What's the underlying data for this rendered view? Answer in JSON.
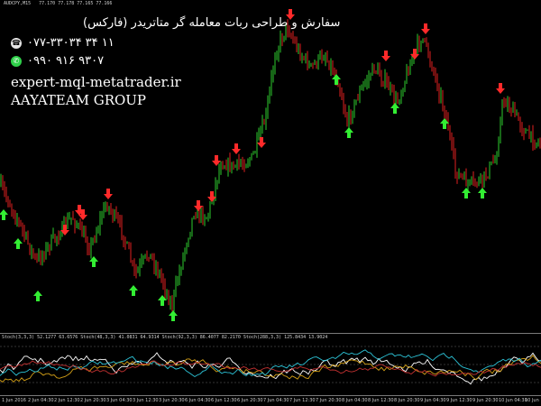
{
  "chart": {
    "header": "AUDCPY,M15   77.170 77.178 77.165 77.166",
    "oscillator_header": "Stoch(3,3,3) 52.1277 63.6576   Stoch(48,3,3) 41.0831 64.9314   Stoch(92,3,3) 86.4077 82.2170   Stoch(288,3,3) 125.8434 13.9024",
    "colors": {
      "bull": "#2ecc2e",
      "bear": "#e02020",
      "buy_arrow": "#33ee33",
      "sell_arrow": "#ff2a2a",
      "osc_lines": [
        "#ffffff",
        "#d4a017",
        "#2cc4d8",
        "#c03030"
      ]
    }
  },
  "promo": {
    "title": "سفارش و طراحی ربات معامله گر متاتریدر (فارکس)",
    "phone": "۰۷۷-۳۳۰۳۴ ۳۴ ۱۱",
    "phone_icon": "phone-icon",
    "whatsapp": "۰۹۹۰ ۹۱۶ ۹۳۰۷",
    "whatsapp_icon": "whatsapp-icon",
    "website": "expert-mql-metatrader.ir",
    "group": "AAYATEAM GROUP"
  },
  "time_axis": [
    "1 Jun 2016",
    "2 Jun 04:30",
    "2 Jun 12:30",
    "2 Jun 20:30",
    "3 Jun 04:30",
    "3 Jun 12:30",
    "3 Jun 20:30",
    "6 Jun 04:30",
    "6 Jun 12:30",
    "6 Jun 20:30",
    "7 Jun 04:30",
    "7 Jun 12:30",
    "7 Jun 20:30",
    "8 Jun 04:30",
    "8 Jun 12:30",
    "8 Jun 20:30",
    "9 Jun 04:30",
    "9 Jun 12:30",
    "9 Jun 20:30",
    "10 Jun 04:30",
    "10 Jun 12:30"
  ]
}
